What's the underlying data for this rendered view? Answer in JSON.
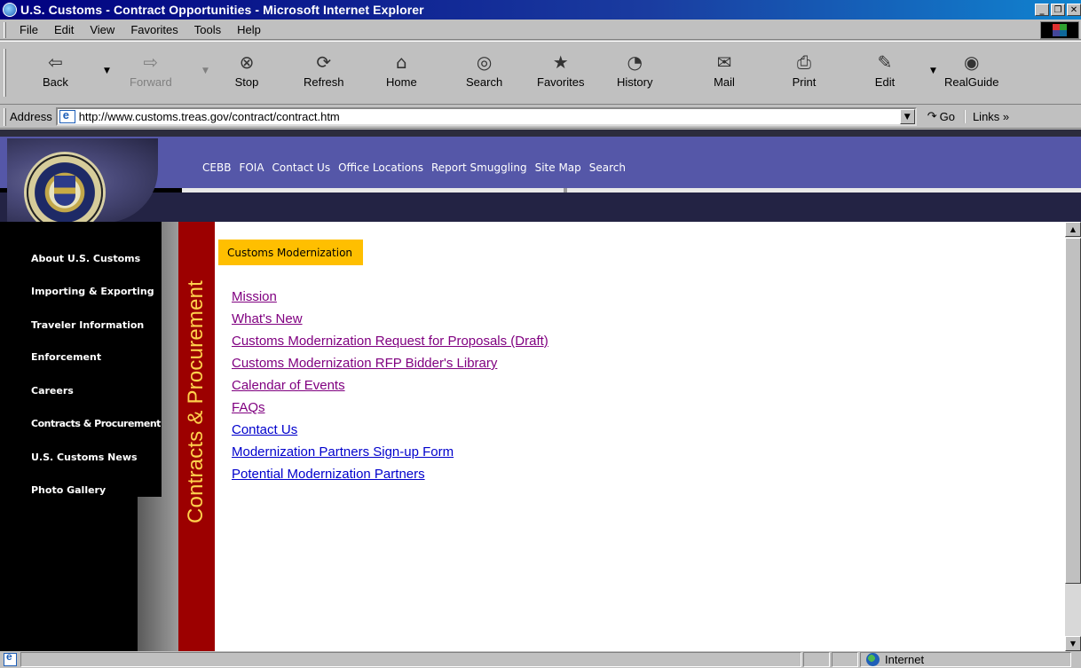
{
  "window": {
    "title": "U.S. Customs - Contract Opportunities - Microsoft Internet Explorer"
  },
  "menu": [
    "File",
    "Edit",
    "View",
    "Favorites",
    "Tools",
    "Help"
  ],
  "toolbar": {
    "back": "Back",
    "forward": "Forward",
    "stop": "Stop",
    "refresh": "Refresh",
    "home": "Home",
    "search": "Search",
    "favorites": "Favorites",
    "history": "History",
    "mail": "Mail",
    "print": "Print",
    "edit": "Edit",
    "realguide": "RealGuide"
  },
  "address": {
    "label": "Address",
    "url": "http://www.customs.treas.gov/contract/contract.htm",
    "go": "Go",
    "links": "Links »"
  },
  "site": {
    "top_nav": [
      "CEBB",
      "FOIA",
      "Contact Us",
      "Office Locations",
      "Report Smuggling",
      "Site Map",
      "Search"
    ],
    "left_nav": [
      "About U.S. Customs",
      "Importing & Exporting",
      "Traveler Information",
      "Enforcement",
      "Careers",
      "Contracts & Procurement",
      "U.S. Customs News",
      "Photo Gallery"
    ],
    "section_vertical": "Contracts & Procurement",
    "section_tab": "Customs Modernization",
    "links": [
      {
        "text": "Mission",
        "visited": true
      },
      {
        "text": "What's New",
        "visited": true
      },
      {
        "text": "Customs Modernization Request for Proposals (Draft)",
        "visited": true
      },
      {
        "text": "Customs Modernization RFP Bidder's Library",
        "visited": true
      },
      {
        "text": "Calendar of Events",
        "visited": true
      },
      {
        "text": "FAQs",
        "visited": true
      },
      {
        "text": "Contact Us",
        "visited": false
      },
      {
        "text": "Modernization Partners Sign-up Form",
        "visited": false
      },
      {
        "text": "Potential Modernization Partners",
        "visited": false
      }
    ]
  },
  "status": {
    "zone": "Internet"
  },
  "colors": {
    "title_bar": "#000080",
    "site_blue": "#5557a8",
    "red_bar": "#9c0000",
    "tab_yellow": "#ffbf00",
    "link_visited": "#800080",
    "link_unvisited": "#0000cc"
  }
}
